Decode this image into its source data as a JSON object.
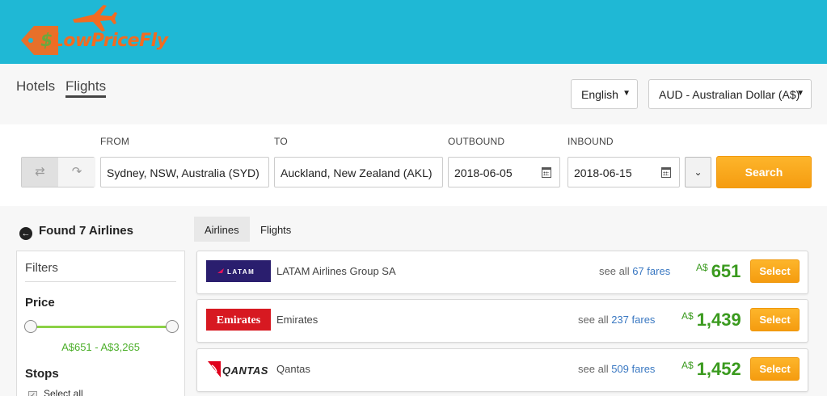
{
  "header": {
    "logo_text_main": "LowPriceFly",
    "logo_prefix": "$"
  },
  "nav": {
    "tabs": [
      {
        "label": "Hotels",
        "active": false
      },
      {
        "label": "Flights",
        "active": true
      }
    ],
    "language": {
      "selected": "English"
    },
    "currency": {
      "selected": "AUD - Australian Dollar (A$)"
    }
  },
  "search": {
    "from_label": "FROM",
    "from_value": "Sydney, NSW, Australia (SYD)",
    "to_label": "TO",
    "to_value": "Auckland, New Zealand (AKL)",
    "outbound_label": "OUTBOUND",
    "outbound_value": "2018-06-05",
    "inbound_label": "INBOUND",
    "inbound_value": "2018-06-15",
    "search_label": "Search"
  },
  "sidebar": {
    "found_text": "Found 7 Airlines",
    "filters_title": "Filters",
    "price_title": "Price",
    "price_range": "A$651 - A$3,265",
    "stops_title": "Stops",
    "select_all": "Select all"
  },
  "results": {
    "tabs": [
      {
        "label": "Airlines",
        "active": true
      },
      {
        "label": "Flights",
        "active": false
      }
    ],
    "see_all_prefix": "see all",
    "fares_suffix": "fares",
    "select_label": "Select",
    "items": [
      {
        "name": "LATAM Airlines Group SA",
        "fares_count": "67",
        "currency": "A$",
        "price": "651",
        "logo": "LATAM",
        "logo_color": "#2a1e6e"
      },
      {
        "name": "Emirates",
        "fares_count": "237",
        "currency": "A$",
        "price": "1,439",
        "logo": "Emirates",
        "logo_color": "#d71921"
      },
      {
        "name": "Qantas",
        "fares_count": "509",
        "currency": "A$",
        "price": "1,452",
        "logo": "QANTAS",
        "logo_color": "#e0001b"
      }
    ]
  },
  "colors": {
    "header_bg": "#1fb8d5",
    "accent_orange": "#f59c10",
    "price_green": "#3a9a1e",
    "link_blue": "#3a78c2"
  }
}
